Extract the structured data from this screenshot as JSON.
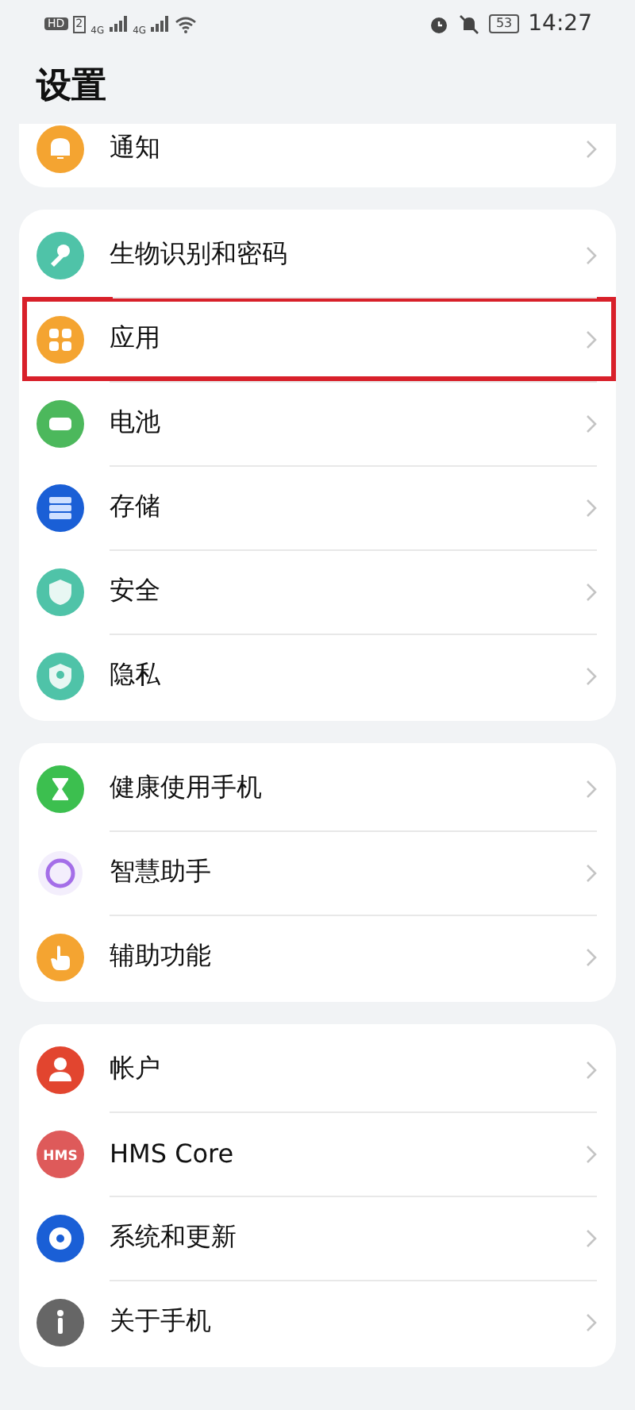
{
  "status_bar": {
    "hd_badge": "HD",
    "sim": "2",
    "networks": [
      "4G",
      "4G"
    ],
    "battery": "53",
    "time": "14:27"
  },
  "title": "设置",
  "groups": [
    {
      "cut_top": true,
      "items": [
        {
          "label": "通知",
          "kind": "bell",
          "color": "#f4a431",
          "highlighted": false
        }
      ]
    },
    {
      "cut_top": false,
      "items": [
        {
          "label": "生物识别和密码",
          "kind": "key",
          "color": "#4fc3a8",
          "highlighted": false
        },
        {
          "label": "应用",
          "kind": "apps",
          "color": "#f4a431",
          "highlighted": true
        },
        {
          "label": "电池",
          "kind": "battery",
          "color": "#4cb85c",
          "highlighted": false
        },
        {
          "label": "存储",
          "kind": "storage",
          "color": "#1a5fd6",
          "highlighted": false
        },
        {
          "label": "安全",
          "kind": "shield",
          "color": "#4fc3a8",
          "highlighted": false
        },
        {
          "label": "隐私",
          "kind": "privacy",
          "color": "#4fc3a8",
          "highlighted": false
        }
      ]
    },
    {
      "cut_top": false,
      "items": [
        {
          "label": "健康使用手机",
          "kind": "hourglass",
          "color": "#3cbf4f",
          "highlighted": false
        },
        {
          "label": "智慧助手",
          "kind": "assistant",
          "color": "#a46ee8",
          "highlighted": false
        },
        {
          "label": "辅助功能",
          "kind": "hand",
          "color": "#f4a431",
          "highlighted": false
        }
      ]
    },
    {
      "cut_top": false,
      "items": [
        {
          "label": "帐户",
          "kind": "person",
          "color": "#e2452f",
          "highlighted": false
        },
        {
          "label": "HMS Core",
          "kind": "hms",
          "color": "#de5a5a",
          "badge_text": "HMS",
          "highlighted": false
        },
        {
          "label": "系统和更新",
          "kind": "gear",
          "color": "#1a5fd6",
          "highlighted": false
        },
        {
          "label": "关于手机",
          "kind": "info",
          "color": "#666666",
          "highlighted": false
        }
      ]
    }
  ]
}
